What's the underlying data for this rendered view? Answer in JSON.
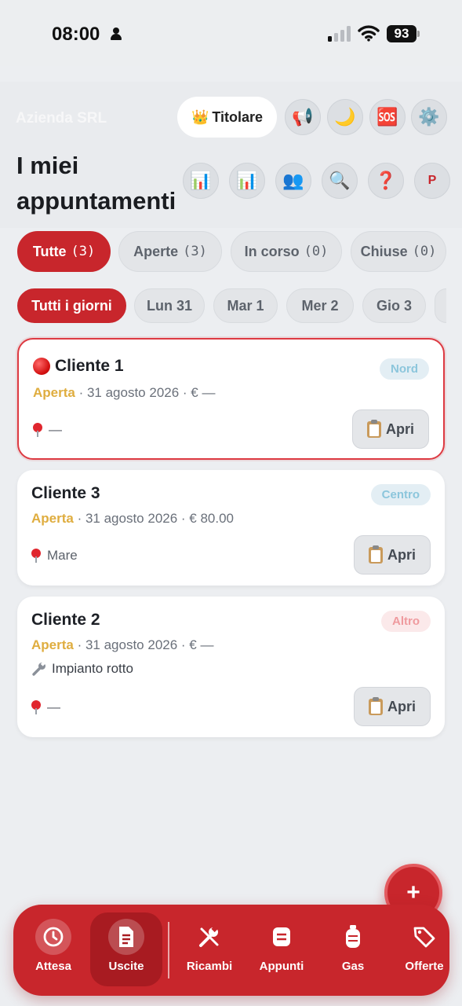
{
  "status_bar": {
    "time": "08:00",
    "battery": "93"
  },
  "header": {
    "company": "Azienda SRL",
    "role_emoji": "👑",
    "role_label": "Titolare",
    "title_line1": "I miei",
    "title_line2": "appuntamenti",
    "icons_row1": [
      "📢",
      "🌙",
      "🆘",
      "⚙️"
    ],
    "icons_row2": [
      "📊",
      "📊",
      "👥",
      "🔍",
      "❓",
      "P"
    ]
  },
  "filters": [
    {
      "label": "Tutte",
      "count": "(3)"
    },
    {
      "label": "Aperte",
      "count": "(3)"
    },
    {
      "label": "In corso",
      "count": "(0)"
    },
    {
      "label": "Chiuse",
      "count": "(0)"
    }
  ],
  "days": [
    "Tutti i giorni",
    "Lun 31",
    "Mar 1",
    "Mer 2",
    "Gio 3"
  ],
  "appointments": [
    {
      "client": "Cliente 1",
      "zone": "Nord",
      "zone_bg": "#e3eef4",
      "zone_fg": "#8cc6dc",
      "status": "Aperta",
      "details": " · 31 agosto 2026 · € —",
      "place": "—",
      "open_label": "Apri"
    },
    {
      "client": "Cliente 3",
      "zone": "Centro",
      "zone_bg": "#e3eef4",
      "zone_fg": "#8cc6dc",
      "status": "Aperta",
      "details": " · 31 agosto 2026 · € 80.00",
      "place": "Mare",
      "open_label": "Apri"
    },
    {
      "client": "Cliente 2",
      "zone": "Altro",
      "zone_bg": "#fbe9ea",
      "zone_fg": "#ef9a9e",
      "status": "Aperta",
      "details": " · 31 agosto 2026 · € —",
      "note": "Impianto rotto",
      "place": "—",
      "open_label": "Apri"
    }
  ],
  "fab": "+",
  "nav": [
    {
      "label": "Attesa",
      "icon": "clock-icon"
    },
    {
      "label": "Uscite",
      "icon": "document-icon"
    },
    {
      "label": "Ricambi",
      "icon": "tools-icon"
    },
    {
      "label": "Appunti",
      "icon": "notes-icon"
    },
    {
      "label": "Gas",
      "icon": "gas-cylinder-icon"
    },
    {
      "label": "Offerte",
      "icon": "tag-icon"
    }
  ],
  "colors": {
    "accent": "#c8262c",
    "status_open": "#dfad3f"
  }
}
